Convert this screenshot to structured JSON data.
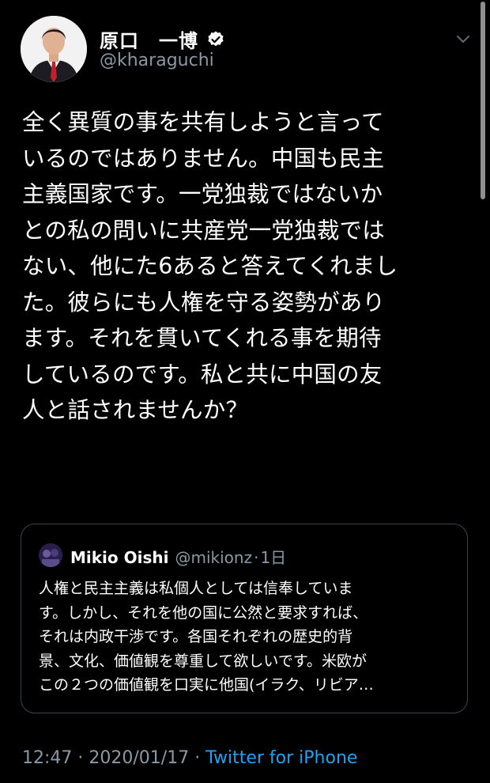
{
  "author": {
    "display_name": "原口　一博",
    "handle": "@kharaguchi",
    "verified": true
  },
  "tweet": {
    "text": "全く異質の事を共有しようと言って\nいるのではありません。中国も民主\n主義国家です。一党独裁ではないか\nとの私の問いに共産党一党独裁では\nない、他にた6あると答えてくれまし\nた。彼らにも人権を守る姿勢があり\nます。それを貫いてくれる事を期待\nしているのです。私と共に中国の友\n人と話されませんか？"
  },
  "quoted_tweet": {
    "display_name": "Mikio Oishi",
    "handle": "@mikionz",
    "separator": "·",
    "age": "1日",
    "text": "人権と民主主義は私個人としては信奉していま\nす。しかし、それを他の国に公然と要求すれば、\nそれは内政干渉です。各国それぞれの歴史的背\n景、文化、価値観を尊重して欲しいです。米欧が\nこの２つの価値観を口実に他国(イラク、リビア…"
  },
  "footer": {
    "time": "12:47",
    "separator1": " · ",
    "date": "2020/01/17",
    "separator2": " · ",
    "source": "Twitter for iPhone"
  },
  "icons": {
    "verified": "verified-badge-icon",
    "more": "chevron-down-icon"
  },
  "colors": {
    "background": "#000000",
    "secondary_text": "#8899a6",
    "link": "#1da1f2",
    "border": "#38444d"
  }
}
